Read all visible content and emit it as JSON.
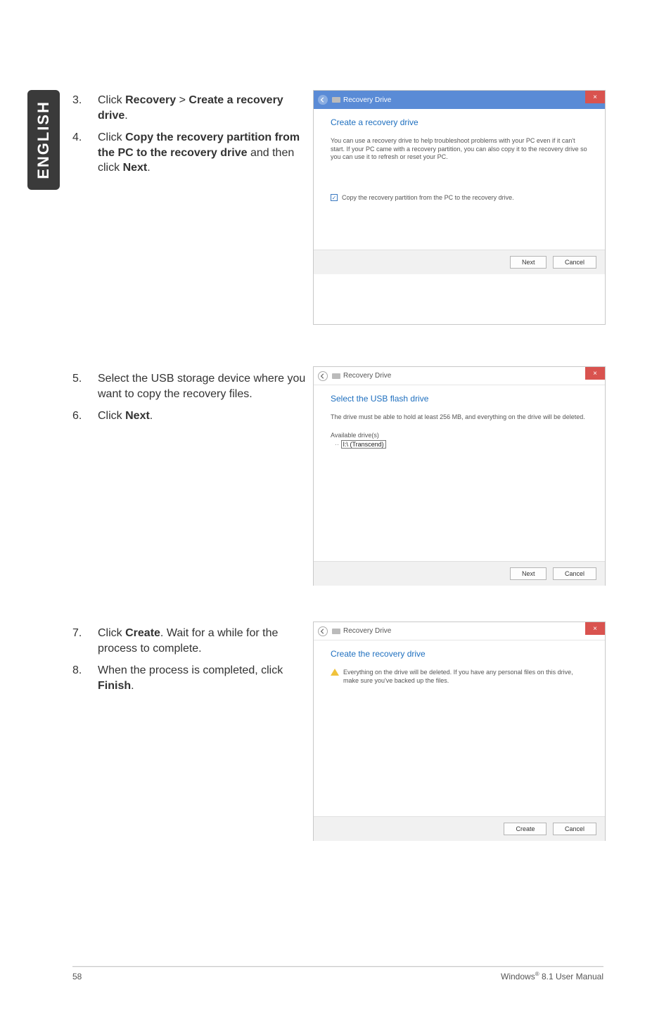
{
  "sidebar": {
    "label": "ENGLISH"
  },
  "steps": {
    "s3": {
      "num": "3.",
      "prefix": "Click ",
      "bold1": "Recovery",
      "mid1": " > ",
      "bold2": "Create a recovery drive",
      "suffix": "."
    },
    "s4": {
      "num": "4.",
      "prefix": "Click ",
      "bold1": "Copy the recovery partition from the PC to the recovery drive",
      "mid1": " and then click ",
      "bold2": "Next",
      "suffix": "."
    },
    "s5": {
      "num": "5.",
      "text": "Select the USB storage device where you want to copy the recovery files."
    },
    "s6": {
      "num": "6.",
      "prefix": "Click ",
      "bold1": "Next",
      "suffix": "."
    },
    "s7": {
      "num": "7.",
      "prefix": "Click ",
      "bold1": "Create",
      "suffix": ". Wait for a while for the process to complete."
    },
    "s8": {
      "num": "8.",
      "prefix": "When the process is completed, click ",
      "bold1": "Finish",
      "suffix": "."
    }
  },
  "dialog1": {
    "title": "Recovery Drive",
    "heading": "Create a recovery drive",
    "para": "You can use a recovery drive to help troubleshoot problems with your PC even if it can't start. If your PC came with a recovery partition, you can also copy it to the recovery drive so you can use it to refresh or reset your PC.",
    "checkbox": "Copy the recovery partition from the PC to the recovery drive.",
    "next": "Next",
    "cancel": "Cancel"
  },
  "dialog2": {
    "title": "Recovery Drive",
    "heading": "Select the USB flash drive",
    "para": "The drive must be able to hold at least 256 MB, and everything on the drive will be deleted.",
    "listLabel": "Available drive(s)",
    "listItem": "I:\\ (Transcend)",
    "next": "Next",
    "cancel": "Cancel"
  },
  "dialog3": {
    "title": "Recovery Drive",
    "heading": "Create the recovery drive",
    "warn": "Everything on the drive will be deleted. If you have any personal files on this drive, make sure you've backed up the files.",
    "create": "Create",
    "cancel": "Cancel"
  },
  "footer": {
    "pageNum": "58",
    "rightPrefix": "Windows",
    "rightReg": "®",
    "rightSuffix": " 8.1 User Manual"
  }
}
